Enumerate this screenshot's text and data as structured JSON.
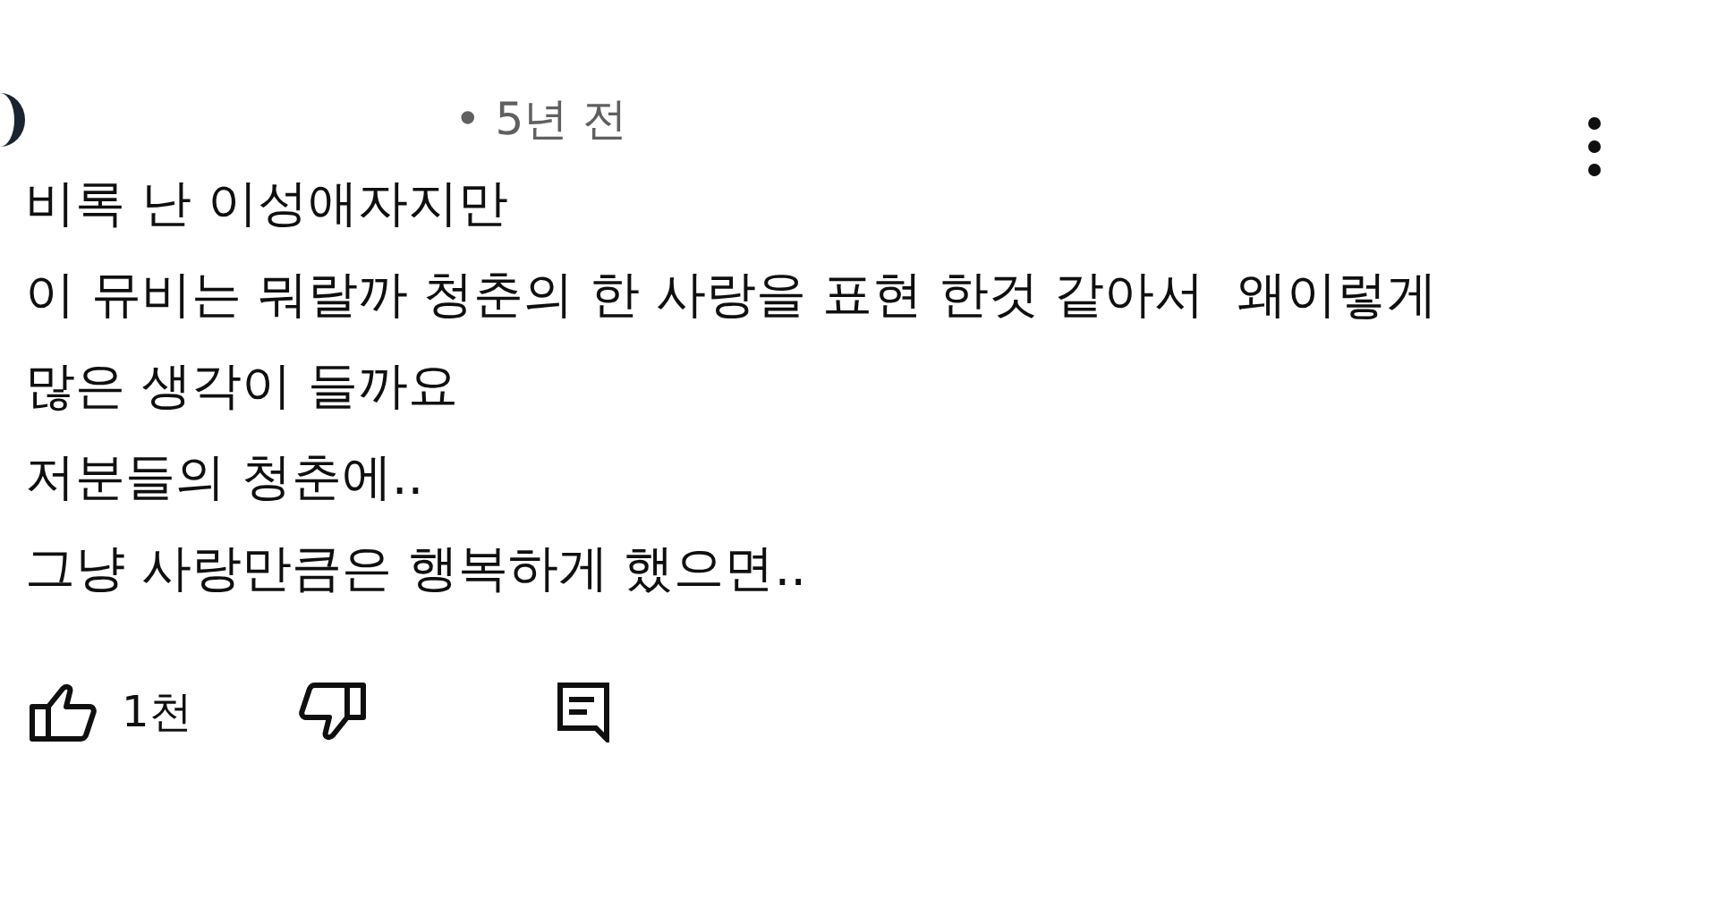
{
  "comment": {
    "meta": "• 5년 전",
    "lines": [
      "비록 난 이성애자지만",
      "이 뮤비는 뭐랄까 청춘의 한 사랑을 표현 한것 같아서  왜이렇게",
      "많은 생각이 들까요",
      "저분들의 청춘에..",
      "그냥 사랑만큼은 행복하게 했으면.."
    ],
    "likes": "1천"
  }
}
